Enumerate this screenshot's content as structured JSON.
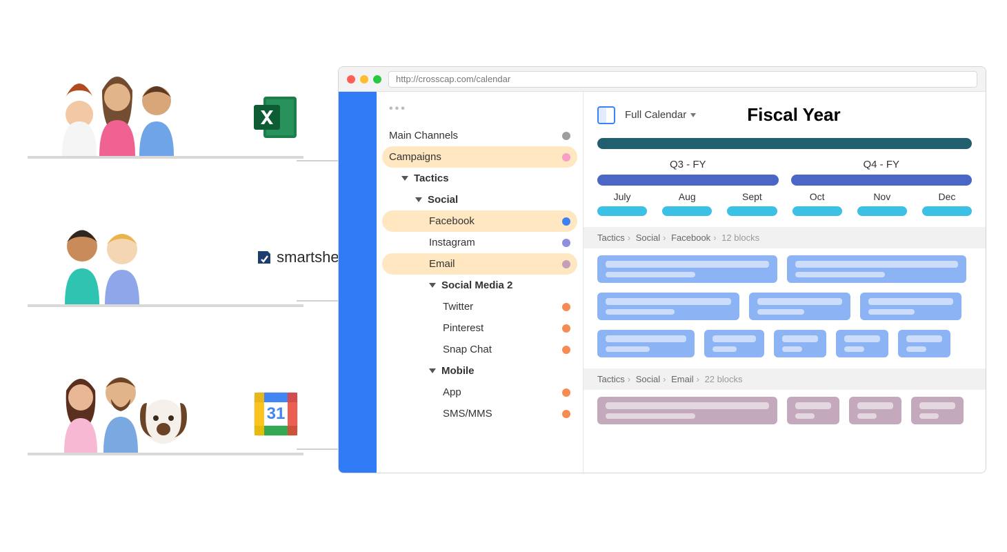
{
  "browser": {
    "url": "http://crosscap.com/calendar"
  },
  "integrations": {
    "row1_app": "Excel",
    "row2_app": "smartsheet",
    "row3_app": "Google Calendar"
  },
  "colors": {
    "dot_gray": "#9e9e9e",
    "dot_pink": "#f5a0c4",
    "dot_blue": "#3b82f6",
    "dot_purple": "#8f8fe0",
    "dot_mauve": "#c3a0b8",
    "dot_orange": "#f78b54"
  },
  "tree": {
    "main_channels": "Main Channels",
    "campaigns": "Campaigns",
    "tactics": "Tactics",
    "social": "Social",
    "facebook": "Facebook",
    "instagram": "Instagram",
    "email": "Email",
    "social_media_2": "Social Media 2",
    "twitter": "Twitter",
    "pinterest": "Pinterest",
    "snapchat": "Snap Chat",
    "mobile": "Mobile",
    "app": "App",
    "sms": "SMS/MMS"
  },
  "main": {
    "view_label": "Full Calendar",
    "title": "Fiscal Year",
    "quarters": {
      "q3": "Q3 - FY",
      "q4": "Q4 - FY"
    },
    "months": {
      "m1": "July",
      "m2": "Aug",
      "m3": "Sept",
      "m4": "Oct",
      "m5": "Nov",
      "m6": "Dec"
    },
    "crumb_fb": {
      "a": "Tactics",
      "b": "Social",
      "c": "Facebook",
      "count": "12 blocks"
    },
    "crumb_em": {
      "a": "Tactics",
      "b": "Social",
      "c": "Email",
      "count": "22 blocks"
    }
  }
}
